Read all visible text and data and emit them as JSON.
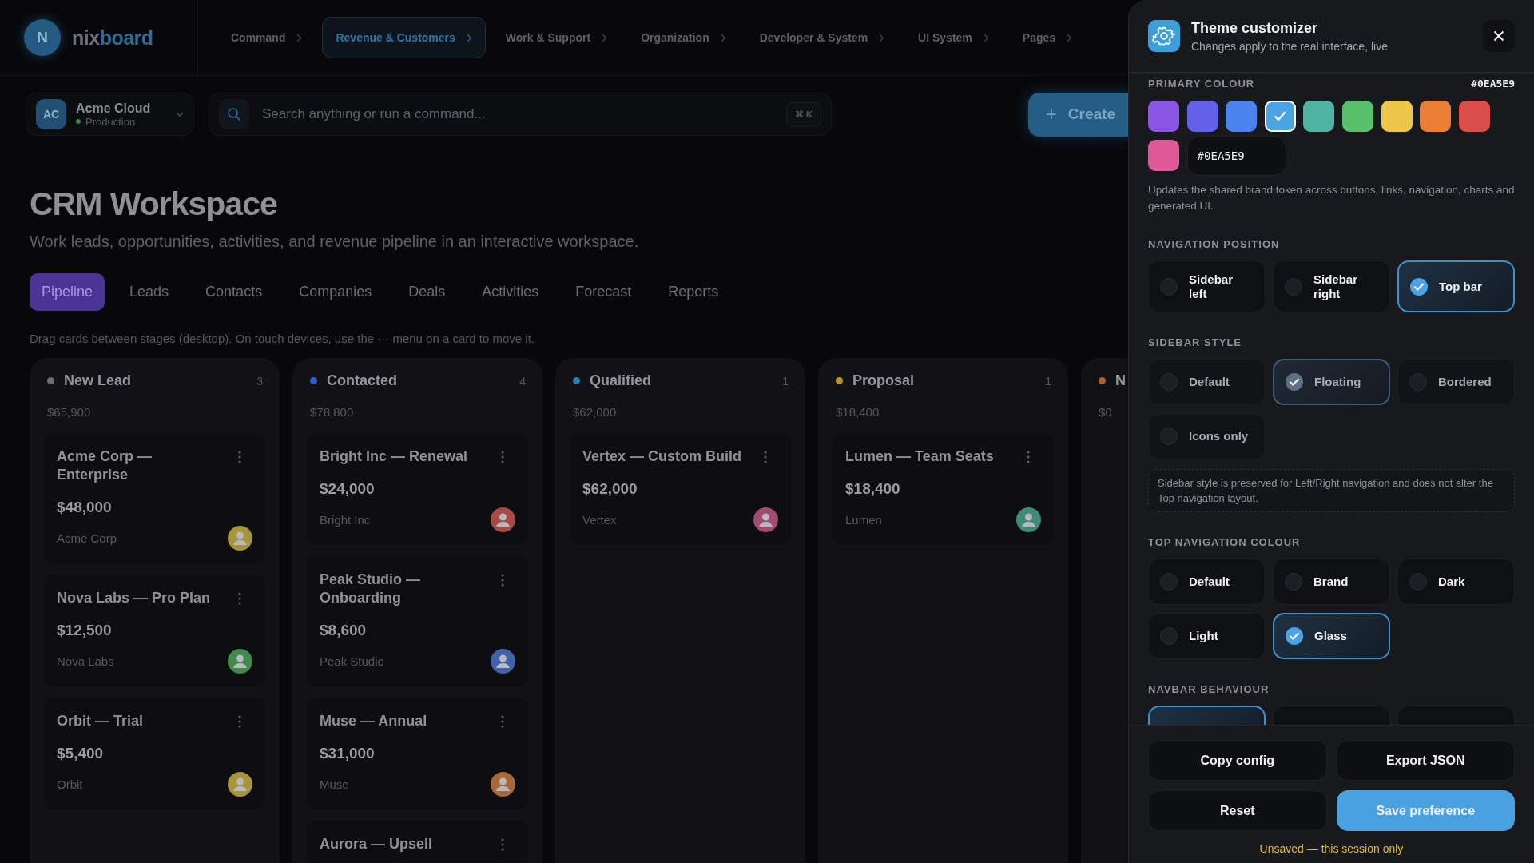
{
  "brand": {
    "initial": "N",
    "name_start": "nix",
    "name_end": "board"
  },
  "top_nav": [
    {
      "label": "Command",
      "selected": false
    },
    {
      "label": "Revenue & Customers",
      "selected": true
    },
    {
      "label": "Work & Support",
      "selected": false
    },
    {
      "label": "Organization",
      "selected": false
    },
    {
      "label": "Developer & System",
      "selected": false
    },
    {
      "label": "UI System",
      "selected": false
    },
    {
      "label": "Pages",
      "selected": false
    }
  ],
  "workspace": {
    "initials": "AC",
    "name": "Acme Cloud",
    "environment": "Production"
  },
  "search": {
    "placeholder": "Search anything or run a command...",
    "shortcut": "⌘ K"
  },
  "create_button": "Create",
  "page": {
    "title": "CRM Workspace",
    "subtitle": "Work leads, opportunities, activities, and revenue pipeline in an interactive workspace."
  },
  "tabs": [
    {
      "label": "Pipeline",
      "selected": true
    },
    {
      "label": "Leads",
      "selected": false
    },
    {
      "label": "Contacts",
      "selected": false
    },
    {
      "label": "Companies",
      "selected": false
    },
    {
      "label": "Deals",
      "selected": false
    },
    {
      "label": "Activities",
      "selected": false
    },
    {
      "label": "Forecast",
      "selected": false
    },
    {
      "label": "Reports",
      "selected": false
    }
  ],
  "hint": "Drag cards between stages (desktop). On touch devices, use the ⋯ menu on a card to move it.",
  "stages": [
    {
      "name": "New Lead",
      "count": "3",
      "total": "$65,900",
      "color": "#6b6d73",
      "deals": [
        {
          "title": "Acme Corp — Enterprise",
          "amount": "$48,000",
          "company": "Acme Corp",
          "color": "#a8943a"
        },
        {
          "title": "Nova Labs — Pro Plan",
          "amount": "$12,500",
          "company": "Nova Labs",
          "color": "#3f8a4c"
        },
        {
          "title": "Orbit — Trial",
          "amount": "$5,400",
          "company": "Orbit",
          "color": "#a8943a"
        }
      ]
    },
    {
      "name": "Contacted",
      "count": "4",
      "total": "$78,800",
      "color": "#2f5fc0",
      "deals": [
        {
          "title": "Bright Inc — Renewal",
          "amount": "$24,000",
          "company": "Bright Inc",
          "color": "#a64a45"
        },
        {
          "title": "Peak Studio — Onboarding",
          "amount": "$8,600",
          "company": "Peak Studio",
          "color": "#3f62a8"
        },
        {
          "title": "Muse — Annual",
          "amount": "$31,000",
          "company": "Muse",
          "color": "#a9683a"
        },
        {
          "title": "Aurora — Upsell"
        }
      ]
    },
    {
      "name": "Qualified",
      "count": "1",
      "total": "$62,000",
      "color": "#2a7fb5",
      "deals": [
        {
          "title": "Vertex — Custom Build",
          "amount": "$62,000",
          "company": "Vertex",
          "color": "#a34a72"
        }
      ]
    },
    {
      "name": "Proposal",
      "count": "1",
      "total": "$18,400",
      "color": "#b8952b",
      "deals": [
        {
          "title": "Lumen — Team Seats",
          "amount": "$18,400",
          "company": "Lumen",
          "color": "#3f8a78"
        }
      ]
    },
    {
      "name": "N",
      "total": "$0",
      "color": "#b0602a"
    }
  ],
  "customizer": {
    "title": "Theme customizer",
    "subtitle": "Changes apply to the real interface, live",
    "primary_colour": {
      "label": "PRIMARY COLOUR",
      "value": "#0EA5E9",
      "swatches": [
        {
          "color": "#8b55e6",
          "selected": false
        },
        {
          "color": "#6461e8",
          "selected": false
        },
        {
          "color": "#4a82ee",
          "selected": false
        },
        {
          "color": "#4aa3e2",
          "selected": true
        },
        {
          "color": "#4fb3a2",
          "selected": false
        },
        {
          "color": "#58c06a",
          "selected": false
        },
        {
          "color": "#edc64a",
          "selected": false
        },
        {
          "color": "#ea7e35",
          "selected": false
        },
        {
          "color": "#db4f4a",
          "selected": false
        },
        {
          "color": "#df5898",
          "selected": false
        }
      ],
      "hex_input": "#0EA5E9",
      "help": "Updates the shared brand token across buttons, links, navigation, charts and generated UI."
    },
    "navigation_position": {
      "label": "NAVIGATION POSITION",
      "options": [
        {
          "label": "Sidebar left",
          "selected": false
        },
        {
          "label": "Sidebar right",
          "selected": false
        },
        {
          "label": "Top bar",
          "selected": true
        }
      ]
    },
    "sidebar_style": {
      "label": "SIDEBAR STYLE",
      "disabled": true,
      "options": [
        {
          "label": "Default",
          "selected": false
        },
        {
          "label": "Floating",
          "selected": true
        },
        {
          "label": "Bordered",
          "selected": false
        },
        {
          "label": "Icons only",
          "selected": false
        }
      ],
      "note": "Sidebar style is preserved for Left/Right navigation and does not alter the Top navigation layout."
    },
    "top_navigation_colour": {
      "label": "TOP NAVIGATION COLOUR",
      "options": [
        {
          "label": "Default",
          "selected": false
        },
        {
          "label": "Brand",
          "selected": false
        },
        {
          "label": "Dark",
          "selected": false
        },
        {
          "label": "Light",
          "selected": false
        },
        {
          "label": "Glass",
          "selected": true
        }
      ]
    },
    "navbar_behaviour": {
      "label": "NAVBAR BEHAVIOUR",
      "options": [
        {
          "selected": true
        },
        {
          "selected": false
        },
        {
          "selected": false
        }
      ]
    },
    "actions": [
      {
        "label": "Copy config",
        "kind": "secondary"
      },
      {
        "label": "Export JSON",
        "kind": "secondary"
      },
      {
        "label": "Reset",
        "kind": "secondary"
      },
      {
        "label": "Save preference",
        "kind": "primary"
      }
    ],
    "status": "Unsaved — this session only"
  }
}
